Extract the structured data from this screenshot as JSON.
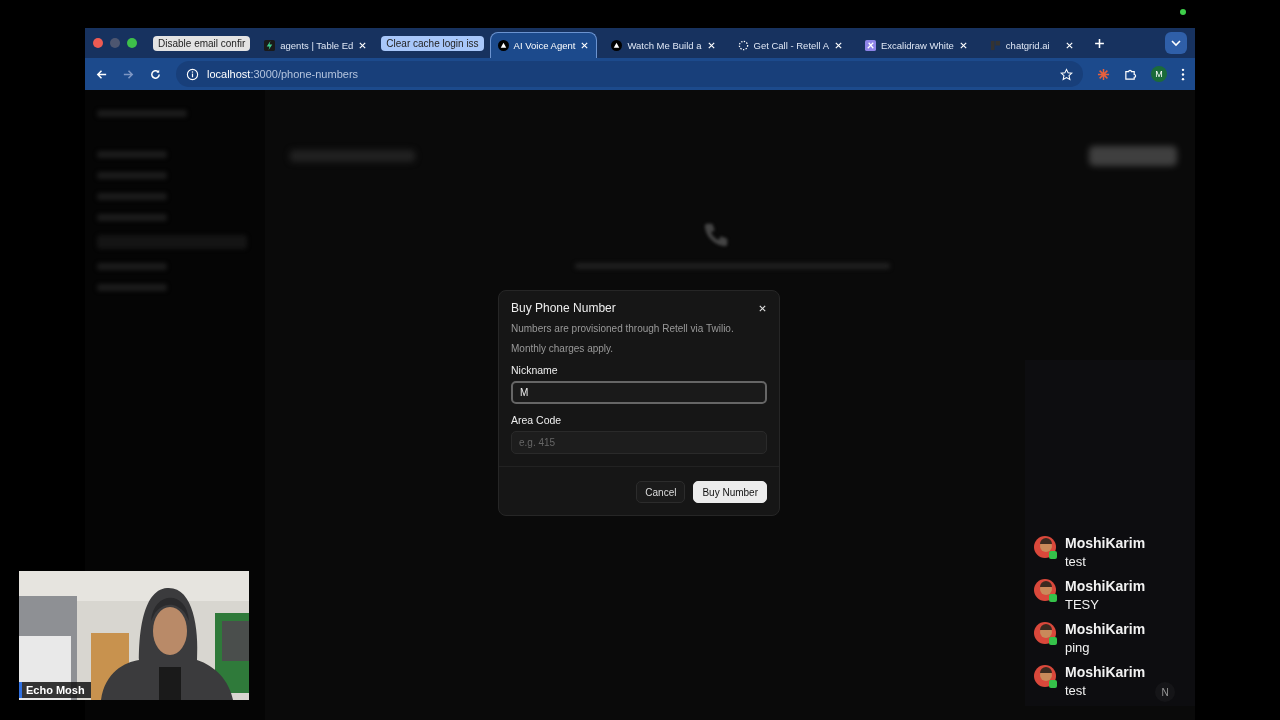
{
  "browser": {
    "tabs": [
      {
        "kind": "group",
        "label": "Disable email confir",
        "color": "#e3e3e3"
      },
      {
        "kind": "tab",
        "label": "agents | Table Ed",
        "selected": false
      },
      {
        "kind": "group",
        "label": "Clear cache login iss",
        "color": "#a8c7fa"
      },
      {
        "kind": "tab",
        "label": "AI Voice Agent",
        "selected": true
      },
      {
        "kind": "tab",
        "label": "Watch Me Build a",
        "selected": false
      },
      {
        "kind": "tab",
        "label": "Get Call - Retell A",
        "selected": false
      },
      {
        "kind": "tab",
        "label": "Excalidraw White",
        "selected": false
      },
      {
        "kind": "tab",
        "label": "chatgrid.ai",
        "selected": false
      }
    ],
    "url_host": "localhost",
    "url_path": ":3000/phone-numbers",
    "profile": "M"
  },
  "dialog": {
    "title": "Buy Phone Number",
    "description": [
      "Numbers are provisioned through Retell via Twilio.",
      "Monthly charges apply."
    ],
    "fields": [
      {
        "label": "Nickname",
        "value": "M",
        "focused": true
      },
      {
        "label": "Area Code",
        "placeholder": "e.g. 415",
        "focused": false
      }
    ],
    "buttons": [
      {
        "label": "Cancel",
        "kind": "secondary"
      },
      {
        "label": "Buy Number",
        "kind": "primary"
      }
    ]
  },
  "chat": {
    "messages": [
      {
        "author": "MoshiKarim",
        "text": "test"
      },
      {
        "author": "MoshiKarim",
        "text": "TESY"
      },
      {
        "author": "MoshiKarim",
        "text": "ping"
      },
      {
        "author": "MoshiKarim",
        "text": "test"
      }
    ],
    "badge": "N"
  },
  "webcam": {
    "name": "Echo Mosh"
  }
}
